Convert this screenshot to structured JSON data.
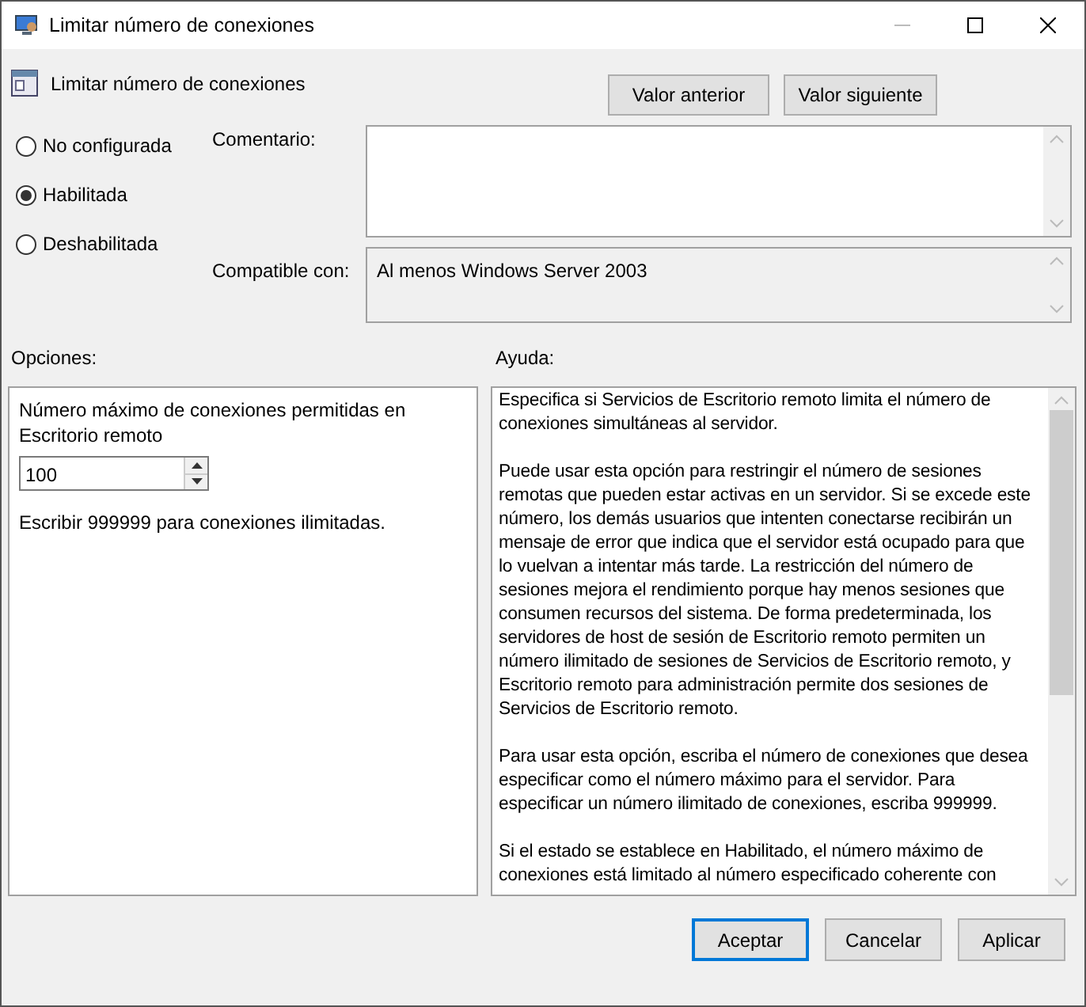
{
  "window": {
    "title": "Limitar número de conexiones"
  },
  "policy": {
    "name": "Limitar número de conexiones"
  },
  "nav_buttons": [
    "Valor anterior",
    "Valor siguiente"
  ],
  "states": [
    {
      "label": "No configurada",
      "selected": false
    },
    {
      "label": "Habilitada",
      "selected": true
    },
    {
      "label": "Deshabilitada",
      "selected": false
    }
  ],
  "comment": {
    "label": "Comentario:"
  },
  "compatible": {
    "label": "Compatible con:",
    "value": "Al menos Windows Server 2003"
  },
  "options": {
    "label": "Opciones:",
    "field_label": "Número máximo de conexiones permitidas en Escritorio remoto",
    "value": "100",
    "hint": "Escribir 999999 para conexiones ilimitadas."
  },
  "help": {
    "label": "Ayuda:",
    "paragraphs": [
      "Especifica si Servicios de Escritorio remoto limita el número de conexiones simultáneas al servidor.",
      "Puede usar esta opción para restringir el número de sesiones remotas que pueden estar activas en un servidor. Si se excede este número, los demás usuarios que intenten conectarse recibirán un mensaje de error que indica que el servidor está ocupado para que lo vuelvan a intentar más tarde. La restricción del número de sesiones mejora el rendimiento porque hay menos sesiones que consumen recursos del sistema. De forma predeterminada, los servidores de host de sesión de Escritorio remoto permiten un número ilimitado de sesiones de Servicios de Escritorio remoto, y Escritorio remoto para administración permite dos sesiones de Servicios de Escritorio remoto.",
      "Para usar esta opción, escriba el número de conexiones que desea especificar como el número máximo para el servidor. Para especificar un número ilimitado de conexiones, escriba 999999.",
      "Si el estado se establece en Habilitado, el número máximo de conexiones está limitado al número especificado coherente con"
    ]
  },
  "buttons": [
    {
      "label": "Aceptar",
      "kind": "default"
    },
    {
      "label": "Cancelar",
      "kind": "normal"
    },
    {
      "label": "Aplicar",
      "kind": "normal"
    }
  ]
}
